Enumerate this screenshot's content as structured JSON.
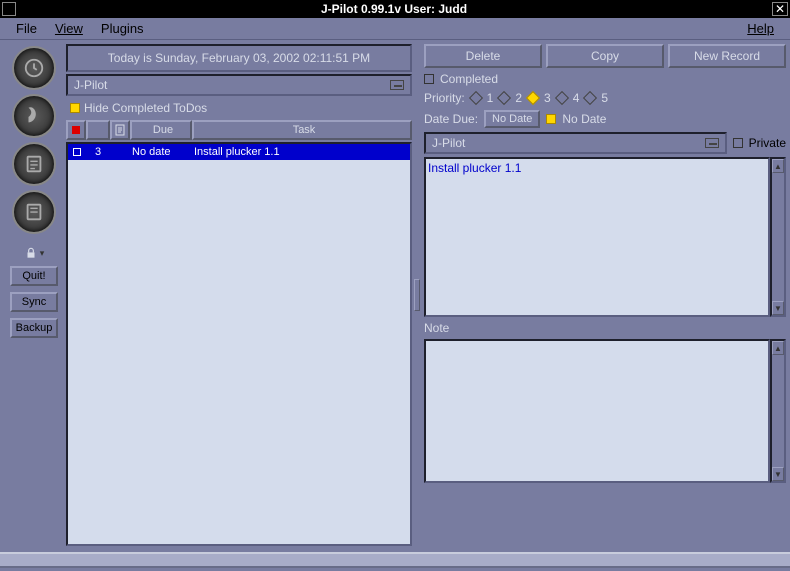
{
  "titlebar": {
    "title": "J-Pilot 0.99.1v User: Judd"
  },
  "menu": {
    "file": "File",
    "view": "View",
    "plugins": "Plugins",
    "help": "Help"
  },
  "sidebar": {
    "quit": "Quit!",
    "sync": "Sync",
    "backup": "Backup"
  },
  "center": {
    "today": "Today is Sunday, February 03, 2002 02:11:51 PM",
    "category": "J-Pilot",
    "hide_completed": "Hide Completed ToDos",
    "cols": {
      "due": "Due",
      "task": "Task"
    },
    "rows": [
      {
        "priority": "3",
        "due": "No date",
        "task": "Install plucker 1.1"
      }
    ]
  },
  "right": {
    "delete": "Delete",
    "copy": "Copy",
    "new_record": "New Record",
    "completed": "Completed",
    "priority_label": "Priority:",
    "priorities": [
      "1",
      "2",
      "3",
      "4",
      "5"
    ],
    "date_due_label": "Date Due:",
    "no_date_btn": "No Date",
    "no_date_check": "No Date",
    "category": "J-Pilot",
    "private": "Private",
    "task_text": "Install plucker 1.1",
    "note_label": "Note",
    "note_text": ""
  }
}
